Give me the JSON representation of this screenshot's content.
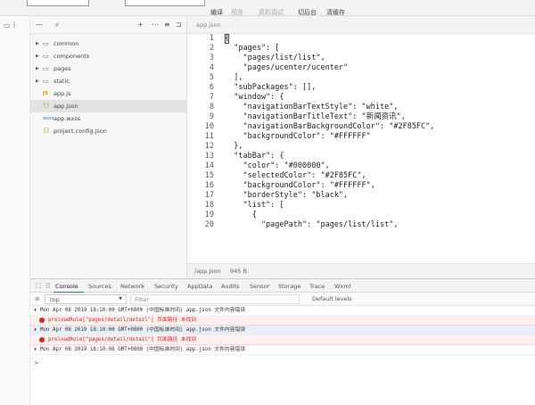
{
  "toolbar": {
    "buttons": [
      "编译",
      "预览",
      "真机调试",
      "切后台",
      "清缓存"
    ]
  },
  "explorer": {
    "items": [
      {
        "label": "common",
        "kind": "folder"
      },
      {
        "label": "components",
        "kind": "folder"
      },
      {
        "label": "pages",
        "kind": "folder"
      },
      {
        "label": "static",
        "kind": "folder"
      },
      {
        "label": "app.js",
        "kind": "js"
      },
      {
        "label": "app.json",
        "kind": "json"
      },
      {
        "label": "app.wxss",
        "kind": "wxss"
      },
      {
        "label": "project.config.json",
        "kind": "json"
      }
    ]
  },
  "editor": {
    "tab_label": "app.json",
    "lines": [
      "{",
      "  \"pages\": [",
      "    \"pages/list/list\",",
      "    \"pages/ucenter/ucenter\"",
      "  ],",
      "  \"subPackages\": [],",
      "  \"window\": {",
      "    \"navigationBarTextStyle\": \"white\",",
      "    \"navigationBarTitleText\": \"新闻资讯\",",
      "    \"navigationBarBackgroundColor\": \"#2F85FC\",",
      "    \"backgroundColor\": \"#FFFFFF\"",
      "  },",
      "  \"tabBar\": {",
      "    \"color\": \"#000000\",",
      "    \"selectedColor\": \"#2F85FC\",",
      "    \"backgroundColor\": \"#FFFFFF\",",
      "    \"borderStyle\": \"black\",",
      "    \"list\": [",
      "      {",
      "        \"pagePath\": \"pages/list/list\","
    ],
    "status_file": "/app.json",
    "status_size": "945 B"
  },
  "devtools": {
    "tabs": [
      "Console",
      "Sources",
      "Network",
      "Security",
      "AppData",
      "Audits",
      "Sensor",
      "Storage",
      "Trace",
      "Wxml"
    ],
    "context_value": "top",
    "filter_placeholder": "Filter",
    "levels_label": "Default levels"
  },
  "console": {
    "rows": [
      {
        "type": "group",
        "text": "Mon Apr 08 2019 18:10:00 GMT+0800 (中国标准时间)  app.json 文件内容错误"
      },
      {
        "type": "error",
        "text": "preloadRule[\"pages/detail/detail\"] 页面路径 未找到"
      },
      {
        "type": "group",
        "text": "Mon Apr 08 2019 18:10:00 GMT+0800 (中国标准时间)  app.json 文件内容错误"
      },
      {
        "type": "error",
        "text": "preloadRule[\"pages/detail/detail\"] 页面路径 未找到"
      },
      {
        "type": "group",
        "text": "Mon Apr 08 2019 18:10:06 GMT+0800 (中国标准时间)  app.json 文件内容错误"
      }
    ],
    "prompt": ">"
  }
}
